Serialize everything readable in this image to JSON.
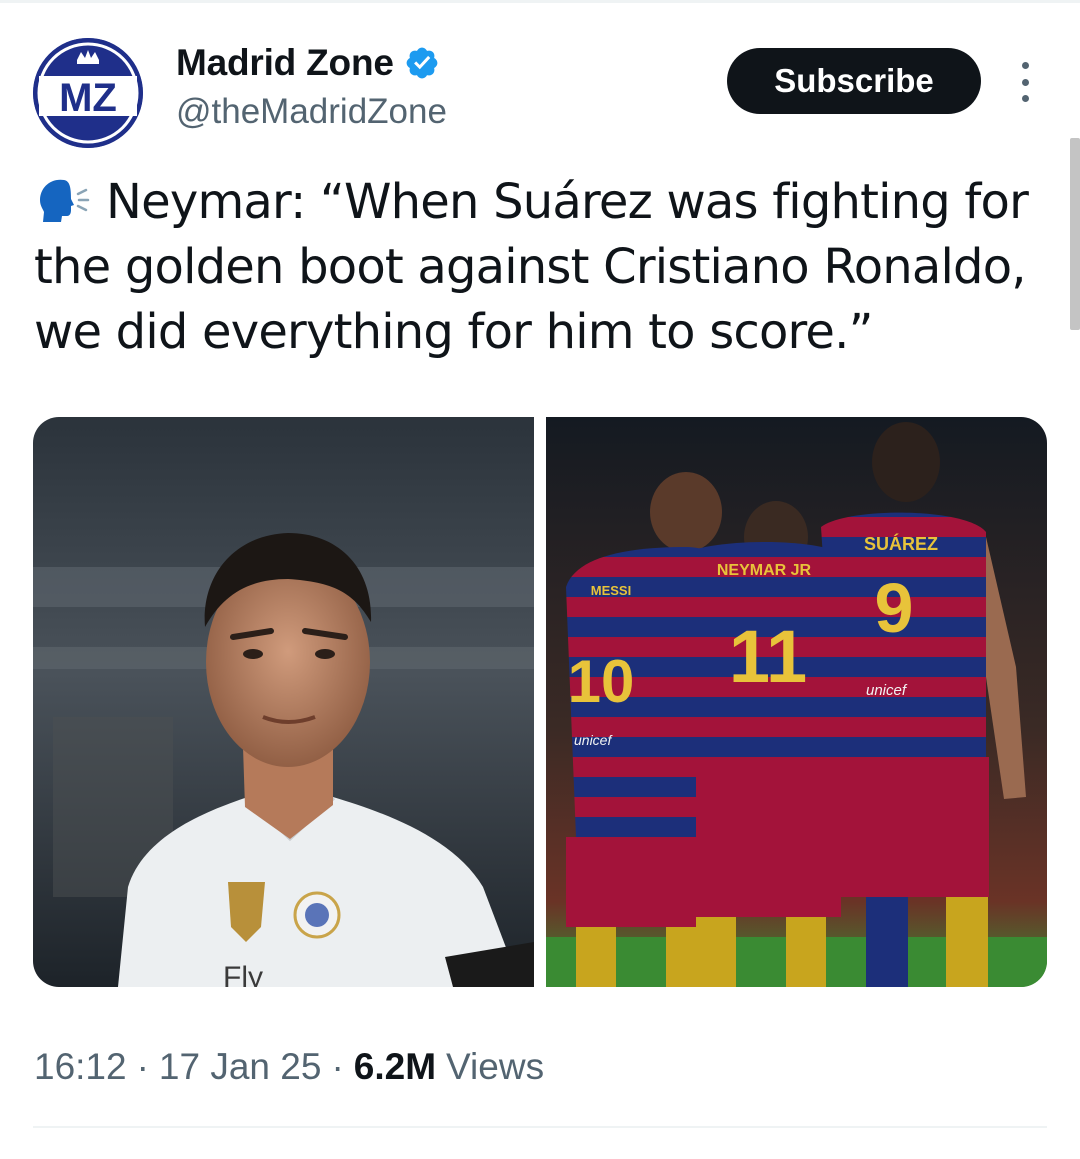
{
  "header": {
    "avatar_text": "MZ",
    "display_name": "Madrid Zone",
    "handle": "@theMadridZone",
    "subscribe_label": "Subscribe"
  },
  "tweet": {
    "text_lines": [
      "Neymar: “When Suárez was fighting for",
      "the golden boot against Cristiano Ronaldo,",
      "we did everything for him to score.”"
    ]
  },
  "media": {
    "left_image_text": "Fly",
    "right_image_texts": {
      "neymar_name": "NEYMAR JR",
      "neymar_number": "11",
      "suarez_name": "SUÁREZ",
      "suarez_number": "9",
      "messi_name": "MESSI",
      "messi_number": "10",
      "sponsor_left": "unicef",
      "sponsor_right": "unicef"
    }
  },
  "meta": {
    "time": "16:12",
    "date": "17 Jan 25",
    "views_count": "6.2M",
    "views_label": "Views"
  },
  "colors": {
    "text_primary": "#0f1419",
    "text_secondary": "#536471",
    "verified_blue": "#1d9bf0",
    "avatar_blue": "#1f2f8a",
    "barca_blue": "#1c2f7a",
    "barca_red": "#a3133a"
  },
  "icons": [
    "verified-badge-icon",
    "more-options-icon",
    "speaking-head-icon"
  ]
}
